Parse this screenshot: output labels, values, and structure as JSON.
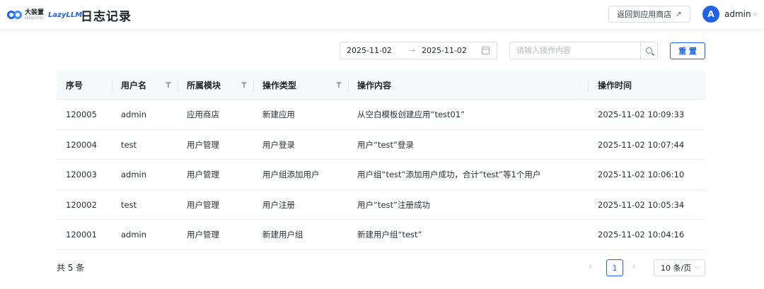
{
  "header": {
    "logo_cn": "大装置",
    "logo_cn_sub": "SENSECORE",
    "logo_en": "LazyLLM",
    "title": "日志记录",
    "back_label": "返回到应用商店",
    "back_icon": "external-arrow-icon",
    "user": {
      "avatar_letter": "A",
      "name": "admin"
    }
  },
  "toolbar": {
    "date_start": "2025-11-02",
    "date_sep": "→",
    "date_end": "2025-11-02",
    "search_placeholder": "请输入操作内容",
    "search_value": "",
    "reset_label": "重 置"
  },
  "table": {
    "columns": [
      {
        "label": "序号"
      },
      {
        "label": "用户名",
        "filter": true
      },
      {
        "label": "所属模块",
        "filter": true
      },
      {
        "label": "操作类型",
        "filter": true
      },
      {
        "label": "操作内容"
      },
      {
        "label": "操作时间"
      }
    ],
    "rows": [
      [
        "120005",
        "admin",
        "应用商店",
        "新建应用",
        "从空白模板创建应用“test01”",
        "2025-11-02 10:09:33"
      ],
      [
        "120004",
        "test",
        "用户管理",
        "用户登录",
        "用户“test”登录",
        "2025-11-02 10:07:44"
      ],
      [
        "120003",
        "admin",
        "用户管理",
        "用户组添加用户",
        "用户组“test”添加用户成功，合计“test”等1个用户",
        "2025-11-02 10:06:10"
      ],
      [
        "120002",
        "test",
        "用户管理",
        "用户注册",
        "用户“test”注册成功",
        "2025-11-02 10:05:34"
      ],
      [
        "120001",
        "admin",
        "用户管理",
        "新建用户组",
        "新建用户组“test”",
        "2025-11-02 10:04:16"
      ]
    ]
  },
  "footer": {
    "total": "共 5 条",
    "prev": "‹",
    "page": "1",
    "next": "›",
    "page_size": "10 条/页"
  },
  "colors": {
    "accent": "#1e63e9"
  }
}
